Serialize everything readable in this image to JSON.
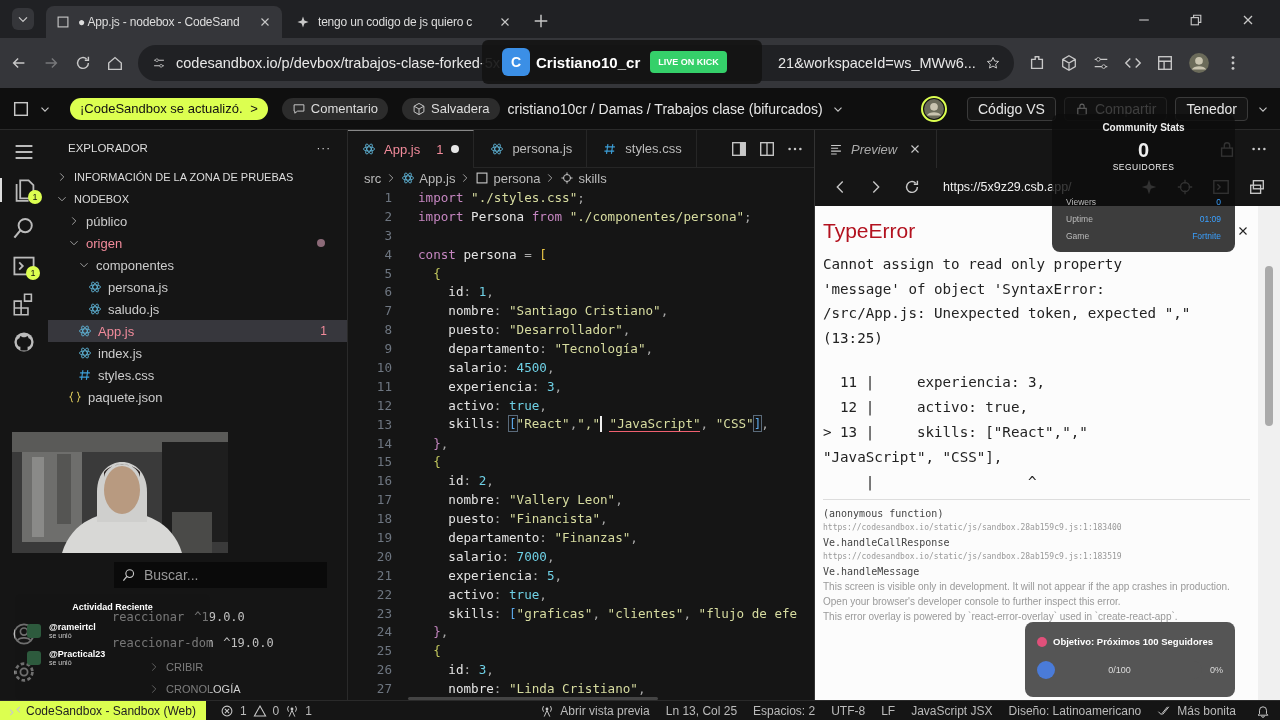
{
  "browser": {
    "tabs": [
      {
        "title": "● App.js - nodebox - CodeSand",
        "selected": true
      },
      {
        "title": "tengo un codigo de js quiero c",
        "selected": false
      }
    ],
    "url_start": "codesandbox.io/p/devbox/trabajos-clase-forked-5x",
    "url_end": "21&workspaceId=ws_MWw6..."
  },
  "toolbar": {
    "update_pill": "¡CodeSandbox se actualizó.",
    "update_arrow": ">",
    "comment": "Comentario",
    "sandbox": "Salvadera",
    "path": "cristiano10cr / Damas / Trabajos clase (bifurcados)",
    "buttons": [
      "Código VS",
      "Compartir",
      "Tenedor"
    ]
  },
  "activity_bar": {
    "badges": [
      {
        "kind": "files",
        "badge": "1"
      },
      {
        "kind": "search"
      },
      {
        "kind": "terminal",
        "badge": "1"
      },
      {
        "kind": "extensions"
      },
      {
        "kind": "github"
      }
    ]
  },
  "sidebar": {
    "title": "EXPLORADOR",
    "more": "···",
    "sections": [
      {
        "label": "INFORMACIÓN DE LA ZONA DE PRUEBAS",
        "expanded": false
      },
      {
        "label": "NODEBOX",
        "expanded": true
      }
    ],
    "tree": [
      {
        "label": "público",
        "kind": "folder",
        "expanded": false
      },
      {
        "label": "origen",
        "kind": "folder",
        "expanded": true,
        "modified": true,
        "children": [
          {
            "label": "componentes",
            "kind": "folder",
            "expanded": true,
            "children": [
              {
                "label": "persona.js",
                "kind": "react"
              },
              {
                "label": "saludo.js",
                "kind": "react"
              }
            ]
          },
          {
            "label": "App.js",
            "kind": "react",
            "selected": true,
            "modified": true,
            "badge": "1"
          },
          {
            "label": "index.js",
            "kind": "react"
          },
          {
            "label": "styles.css",
            "kind": "css"
          }
        ]
      },
      {
        "label": "paquete.json",
        "kind": "json"
      }
    ],
    "search_placeholder": "Buscar...",
    "dependencies": [
      {
        "name": "reaccionar",
        "version": "^19.0.0"
      },
      {
        "name": "reaccionar-dom",
        "version": "^19.0.0"
      }
    ],
    "bottom_sections": [
      "CRIBIR",
      "CRONOLOGÍA"
    ]
  },
  "editor": {
    "tabs": [
      {
        "label": "App.js",
        "kind": "react",
        "selected": true,
        "problems": "1",
        "modified": true
      },
      {
        "label": "persona.js",
        "kind": "react",
        "selected": false
      },
      {
        "label": "styles.css",
        "kind": "css",
        "selected": false
      }
    ],
    "breadcrumb": [
      "src",
      "App.js",
      "persona",
      "skills"
    ],
    "lines": [
      {
        "n": "1",
        "tokens": [
          {
            "kind": "kw",
            "text": "import"
          },
          {
            "kind": "str",
            "text": " \"./styles.css\""
          },
          {
            "kind": "p",
            "text": ";"
          }
        ]
      },
      {
        "n": "2",
        "tokens": [
          {
            "kind": "kw",
            "text": "import"
          },
          {
            "kind": "id",
            "text": " Persona "
          },
          {
            "kind": "kw",
            "text": "from"
          },
          {
            "kind": "str",
            "text": " \"./componentes/persona\""
          },
          {
            "kind": "p",
            "text": ";"
          }
        ]
      },
      {
        "n": "3"
      },
      {
        "n": "4",
        "tokens": [
          {
            "kind": "kw",
            "text": "const"
          },
          {
            "kind": "id",
            "text": " persona "
          },
          {
            "kind": "p",
            "text": "= "
          },
          {
            "kind": "bracket",
            "text": "["
          }
        ]
      },
      {
        "n": "5",
        "tokens": [
          {
            "kind": "open",
            "text": "  {"
          }
        ]
      },
      {
        "n": "6",
        "tokens": [
          {
            "kind": "key",
            "text": "    id"
          },
          {
            "kind": "p",
            "text": ": "
          },
          {
            "kind": "num",
            "text": "1"
          },
          {
            "kind": "p",
            "text": ","
          }
        ]
      },
      {
        "n": "7",
        "tokens": [
          {
            "kind": "key",
            "text": "    nombre"
          },
          {
            "kind": "p",
            "text": ": "
          },
          {
            "kind": "str",
            "text": "\"Santiago Cristiano\""
          },
          {
            "kind": "p",
            "text": ","
          }
        ]
      },
      {
        "n": "8",
        "tokens": [
          {
            "kind": "key",
            "text": "    puesto"
          },
          {
            "kind": "p",
            "text": ": "
          },
          {
            "kind": "str",
            "text": "\"Desarrollador\""
          },
          {
            "kind": "p",
            "text": ","
          }
        ]
      },
      {
        "n": "9",
        "tokens": [
          {
            "kind": "key",
            "text": "    departamento"
          },
          {
            "kind": "p",
            "text": ": "
          },
          {
            "kind": "str",
            "text": "\"Tecnología\""
          },
          {
            "kind": "p",
            "text": ","
          }
        ]
      },
      {
        "n": "10",
        "tokens": [
          {
            "kind": "key",
            "text": "    salario"
          },
          {
            "kind": "p",
            "text": ": "
          },
          {
            "kind": "num",
            "text": "4500"
          },
          {
            "kind": "p",
            "text": ","
          }
        ]
      },
      {
        "n": "11",
        "tokens": [
          {
            "kind": "key",
            "text": "    experiencia"
          },
          {
            "kind": "p",
            "text": ": "
          },
          {
            "kind": "num",
            "text": "3"
          },
          {
            "kind": "p",
            "text": ","
          }
        ]
      },
      {
        "n": "12",
        "tokens": [
          {
            "kind": "key",
            "text": "    activo"
          },
          {
            "kind": "p",
            "text": ": "
          },
          {
            "kind": "num",
            "text": "true"
          },
          {
            "kind": "p",
            "text": ","
          }
        ]
      },
      {
        "n": "13",
        "tokens": [
          {
            "kind": "key",
            "text": "    skills"
          },
          {
            "kind": "p",
            "text": ": "
          },
          {
            "kind": "match",
            "text": "["
          },
          {
            "kind": "str",
            "text": "\"React\""
          },
          {
            "kind": "p",
            "text": ","
          },
          {
            "kind": "str",
            "text": "\",\""
          },
          {
            "kind": "caret"
          },
          {
            "kind": "err",
            "text": " \"JavaScript\""
          },
          {
            "kind": "p",
            "text": ", "
          },
          {
            "kind": "str",
            "text": "\"CSS\""
          },
          {
            "kind": "match",
            "text": "]"
          },
          {
            "kind": "p",
            "text": ","
          }
        ]
      },
      {
        "n": "14",
        "tokens": [
          {
            "kind": "close",
            "text": "  }"
          },
          {
            "kind": "p",
            "text": ","
          }
        ]
      },
      {
        "n": "15",
        "tokens": [
          {
            "kind": "open",
            "text": "  {"
          }
        ]
      },
      {
        "n": "16",
        "tokens": [
          {
            "kind": "key",
            "text": "    id"
          },
          {
            "kind": "p",
            "text": ": "
          },
          {
            "kind": "num",
            "text": "2"
          },
          {
            "kind": "p",
            "text": ","
          }
        ]
      },
      {
        "n": "17",
        "tokens": [
          {
            "kind": "key",
            "text": "    nombre"
          },
          {
            "kind": "p",
            "text": ": "
          },
          {
            "kind": "str",
            "text": "\"Vallery Leon\""
          },
          {
            "kind": "p",
            "text": ","
          }
        ]
      },
      {
        "n": "18",
        "tokens": [
          {
            "kind": "key",
            "text": "    puesto"
          },
          {
            "kind": "p",
            "text": ": "
          },
          {
            "kind": "str",
            "text": "\"Financista\""
          },
          {
            "kind": "p",
            "text": ","
          }
        ]
      },
      {
        "n": "19",
        "tokens": [
          {
            "kind": "key",
            "text": "    departamento"
          },
          {
            "kind": "p",
            "text": ": "
          },
          {
            "kind": "str",
            "text": "\"Finanzas\""
          },
          {
            "kind": "p",
            "text": ","
          }
        ]
      },
      {
        "n": "20",
        "tokens": [
          {
            "kind": "key",
            "text": "    salario"
          },
          {
            "kind": "p",
            "text": ": "
          },
          {
            "kind": "num",
            "text": "7000"
          },
          {
            "kind": "p",
            "text": ","
          }
        ]
      },
      {
        "n": "21",
        "tokens": [
          {
            "kind": "key",
            "text": "    experiencia"
          },
          {
            "kind": "p",
            "text": ": "
          },
          {
            "kind": "num",
            "text": "5"
          },
          {
            "kind": "p",
            "text": ","
          }
        ]
      },
      {
        "n": "22",
        "tokens": [
          {
            "kind": "key",
            "text": "    activo"
          },
          {
            "kind": "p",
            "text": ": "
          },
          {
            "kind": "num",
            "text": "true"
          },
          {
            "kind": "p",
            "text": ","
          }
        ]
      },
      {
        "n": "23",
        "tokens": [
          {
            "kind": "key",
            "text": "    skills"
          },
          {
            "kind": "p",
            "text": ": "
          },
          {
            "kind": "blue",
            "text": "["
          },
          {
            "kind": "str",
            "text": "\"graficas\""
          },
          {
            "kind": "p",
            "text": ", "
          },
          {
            "kind": "str",
            "text": "\"clientes\""
          },
          {
            "kind": "p",
            "text": ", "
          },
          {
            "kind": "str",
            "text": "\"flujo de efe"
          }
        ]
      },
      {
        "n": "24",
        "tokens": [
          {
            "kind": "close",
            "text": "  }"
          },
          {
            "kind": "p",
            "text": ","
          }
        ]
      },
      {
        "n": "25",
        "tokens": [
          {
            "kind": "open",
            "text": "  {"
          }
        ]
      },
      {
        "n": "26",
        "tokens": [
          {
            "kind": "key",
            "text": "    id"
          },
          {
            "kind": "p",
            "text": ": "
          },
          {
            "kind": "num",
            "text": "3"
          },
          {
            "kind": "p",
            "text": ","
          }
        ]
      },
      {
        "n": "27",
        "tokens": [
          {
            "kind": "key",
            "text": "    nombre"
          },
          {
            "kind": "p",
            "text": ": "
          },
          {
            "kind": "str",
            "text": "\"Linda Cristiano\""
          },
          {
            "kind": "p",
            "text": ","
          }
        ]
      }
    ]
  },
  "preview": {
    "tab": "Preview",
    "url": "https://5x9z29.csb.app/",
    "error": {
      "title": "TypeError",
      "message_lines": [
        "Cannot assign to read only property",
        "'message' of object 'SyntaxError:",
        "/src/App.js: Unexpected token, expected \",\"",
        "(13:25)"
      ],
      "frame": [
        "  11 |     experiencia: 3,",
        "  12 |     activo: true,",
        "> 13 |     skills: [\"React\",\",\"",
        "\"JavaScript\", \"CSS\"],",
        "     |                  ^"
      ],
      "stack": [
        {
          "fn": "(anonymous function)",
          "url": "https://codesandbox.io/static/js/sandbox.28ab159c9.js:1:183400"
        },
        {
          "fn": "Ve.handleCallResponse",
          "url": "https://codesandbox.io/static/js/sandbox.28ab159c9.js:1:183519"
        },
        {
          "fn": "Ve.handleMessage"
        }
      ],
      "footer": [
        "This screen is visible only in development. It will not appear if the app crashes in production.",
        "Open your browser's developer console to further inspect this error.",
        "This error overlay is powered by `react-error-overlay` used in `create-react-app`."
      ]
    }
  },
  "status_bar": {
    "remote": "CodeSandbox - Sandbox (Web)",
    "errors": "1",
    "warnings": "0",
    "ports": "1",
    "right": [
      "Abrir vista previa",
      "Ln 13, Col 25",
      "Espacios: 2",
      "UTF-8",
      "LF",
      "JavaScript JSX",
      "Diseño: Latinoamericano",
      "Más bonita"
    ]
  },
  "overlays": {
    "stream": {
      "initial": "C",
      "channel": "Cristiano10_cr",
      "live": "LIVE ON KICK"
    },
    "community": {
      "title": "Community Stats",
      "followers": "0",
      "followers_label": "SEGUIDORES",
      "stats": [
        {
          "label": "Viewers",
          "value": "0"
        },
        {
          "label": "Uptime",
          "value": "01:09"
        },
        {
          "label": "Game",
          "value": "Fortnite"
        }
      ]
    },
    "activity": {
      "title": "Actividad Reciente",
      "events": [
        {
          "user": "@rameirtcl",
          "action": "se unió"
        },
        {
          "user": "@Practical23",
          "action": "se unió"
        }
      ]
    },
    "goal": {
      "title": "Objetivo: Próximos 100 Seguidores",
      "count": "0/100",
      "percent": "0%",
      "level": 0
    }
  }
}
